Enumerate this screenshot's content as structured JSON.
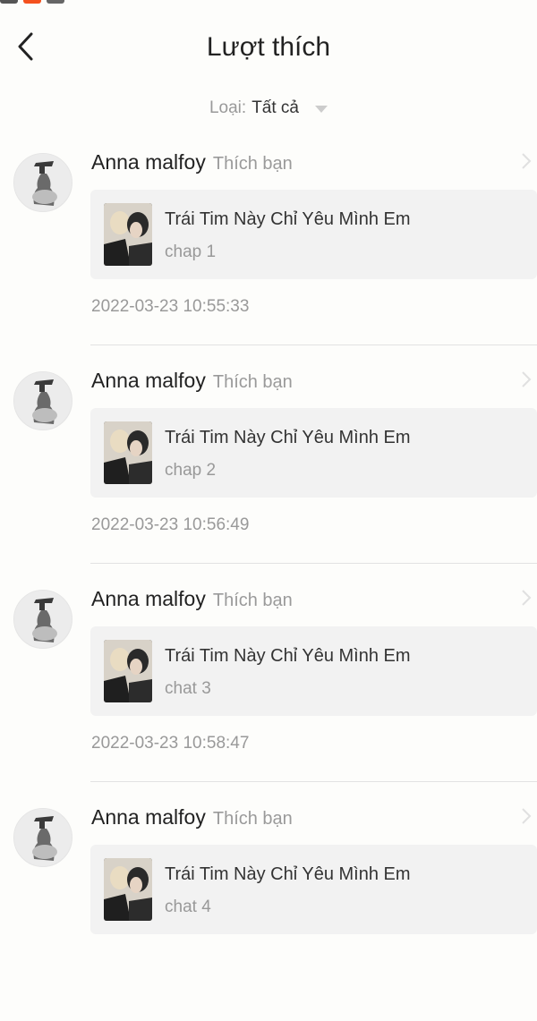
{
  "header": {
    "title": "Lượt thích"
  },
  "filter": {
    "label": "Loại:",
    "value": "Tất cả"
  },
  "items": [
    {
      "user": "Anna malfoy",
      "action": "Thích bạn",
      "story_title": "Trái Tim Này Chỉ Yêu Mình Em",
      "chapter": "chap 1",
      "time": "2022-03-23 10:55:33"
    },
    {
      "user": "Anna malfoy",
      "action": "Thích bạn",
      "story_title": "Trái Tim Này Chỉ Yêu Mình Em",
      "chapter": "chap 2",
      "time": "2022-03-23 10:56:49"
    },
    {
      "user": "Anna malfoy",
      "action": "Thích bạn",
      "story_title": "Trái Tim Này Chỉ Yêu Mình Em",
      "chapter": "chat 3",
      "time": "2022-03-23 10:58:47"
    },
    {
      "user": "Anna malfoy",
      "action": "Thích bạn",
      "story_title": "Trái Tim Này Chỉ Yêu Mình Em",
      "chapter": "chat 4",
      "time": ""
    }
  ],
  "colors": {
    "background": "#fdfdfb",
    "card": "#f2f2f2",
    "muted_text": "#999999",
    "primary_text": "#222222"
  },
  "icons": {
    "back": "chevron-left-icon",
    "filter_arrow": "caret-down-icon",
    "row_chevron": "chevron-right-icon"
  }
}
